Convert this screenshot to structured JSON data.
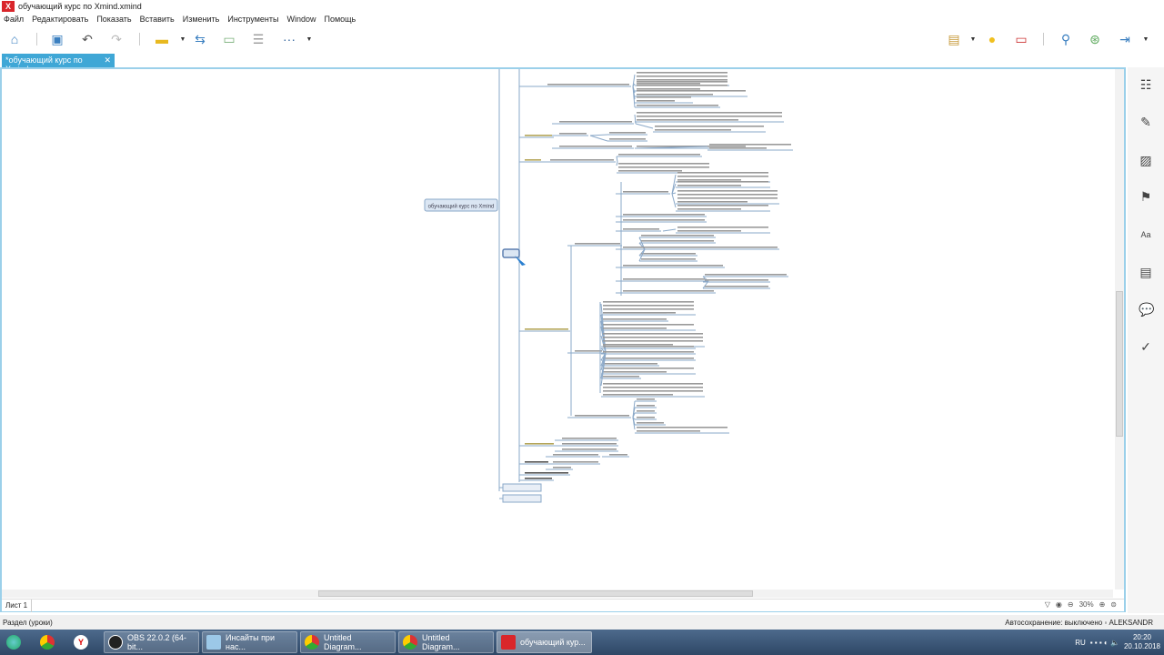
{
  "window": {
    "title": "обучающий курс по Xmind.xmind",
    "logo": "X"
  },
  "menu": [
    "Файл",
    "Редактировать",
    "Показать",
    "Вставить",
    "Изменить",
    "Инструменты",
    "Window",
    "Помощь"
  ],
  "toolbar": {
    "more": "···",
    "icons": [
      "home-icon",
      "save-icon",
      "undo-icon",
      "redo-icon",
      "topic-style-icon",
      "relationship-icon",
      "boundary-icon",
      "summary-icon",
      "more-icon",
      "presentation-icon",
      "idea-icon",
      "gantt-icon",
      "search-icon",
      "share-icon",
      "export-icon"
    ]
  },
  "tab": {
    "label": "*обучающий курс по Xmind",
    "close": "✕"
  },
  "map": {
    "root": "обучающий курс по Xmind"
  },
  "sheet": {
    "label": "Лист 1",
    "zoom": "30%"
  },
  "status": {
    "left": "Раздел (уроки)",
    "right": "Автосохранение: выключено  ◦  ALEKSANDR"
  },
  "taskbar": {
    "items": [
      "OBS 22.0.2 (64-bit...",
      "Инсайты при нас...",
      "Untitled Diagram...",
      "Untitled Diagram...",
      "обучающий кур..."
    ],
    "lang": "RU",
    "time": "20:20",
    "date": "20.10.2018"
  },
  "colors": {
    "accent": "#3fa7d6",
    "branch": "#8aa8c8",
    "taskbar": "#3a5677"
  }
}
